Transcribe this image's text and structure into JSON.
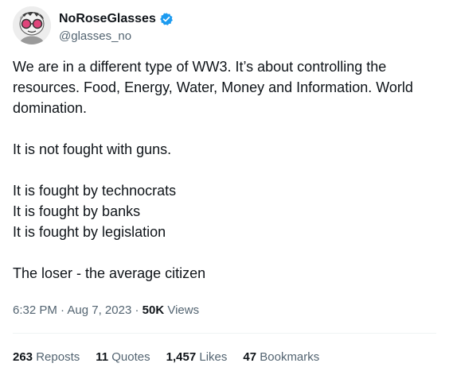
{
  "author": {
    "display_name": "NoRoseGlasses",
    "handle": "@glasses_no",
    "verified_color": "#1d9bf0"
  },
  "tweet": {
    "lines": [
      "We are in a different type of WW3. It’s about controlling the",
      "resources.  Food, Energy, Water, Money and Information.   World",
      "domination.",
      "",
      "It is not fought with guns.",
      "",
      "It is fought by technocrats",
      "It is fought by banks",
      "It is fought by legislation",
      "",
      "The loser - the average citizen"
    ]
  },
  "meta": {
    "time": "6:32 PM",
    "date": "Aug 7, 2023",
    "views_count": "50K",
    "views_label": "Views"
  },
  "stats": {
    "reposts": {
      "count": "263",
      "label": "Reposts"
    },
    "quotes": {
      "count": "11",
      "label": "Quotes"
    },
    "likes": {
      "count": "1,457",
      "label": "Likes"
    },
    "bookmarks": {
      "count": "47",
      "label": "Bookmarks"
    }
  }
}
